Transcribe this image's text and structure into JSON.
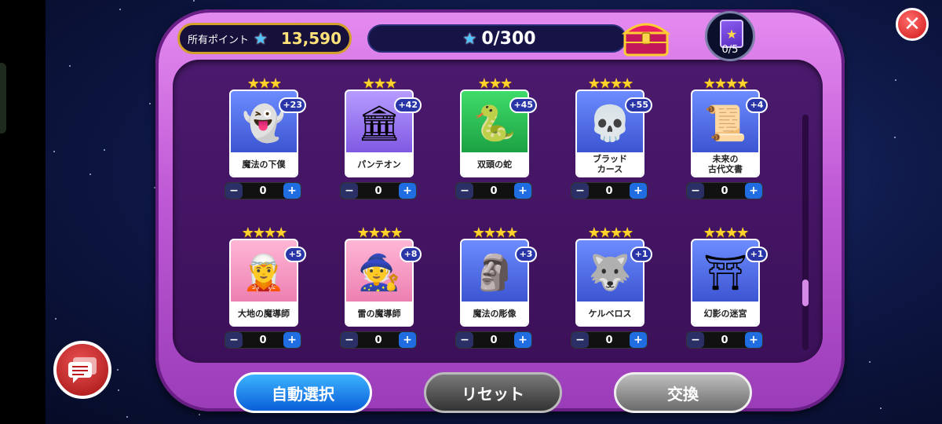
{
  "header": {
    "points_label": "所有ポイント",
    "points_value": "13,590",
    "progress_text": "0/300",
    "card_count": "0/5"
  },
  "items": [
    {
      "name": "魔法の下僕",
      "stars": "★★★",
      "bonus": "+23",
      "qty": "0",
      "bg": "bg-blue",
      "icon": "hooded-ghost-icon",
      "glyph": "👻"
    },
    {
      "name": "パンテオン",
      "stars": "★★★",
      "bonus": "+42",
      "qty": "0",
      "bg": "bg-purple",
      "icon": "temple-icon",
      "glyph": "🏛"
    },
    {
      "name": "双頭の蛇",
      "stars": "★★★",
      "bonus": "+45",
      "qty": "0",
      "bg": "bg-green",
      "icon": "snake-icon",
      "glyph": "🐍"
    },
    {
      "name": "ブラッド\nカース",
      "stars": "★★★★",
      "bonus": "+55",
      "qty": "0",
      "bg": "bg-blue",
      "icon": "blood-skull-chalice-icon",
      "glyph": "💀"
    },
    {
      "name": "未来の\n古代文書",
      "stars": "★★★★",
      "bonus": "+4",
      "qty": "0",
      "bg": "bg-blue",
      "icon": "scroll-icon",
      "glyph": "📜"
    },
    {
      "name": "大地の魔導師",
      "stars": "★★★★",
      "bonus": "+5",
      "qty": "0",
      "bg": "bg-pink",
      "icon": "earth-mage-icon",
      "glyph": "🧝"
    },
    {
      "name": "雷の魔導師",
      "stars": "★★★★",
      "bonus": "+8",
      "qty": "0",
      "bg": "bg-pink",
      "icon": "thunder-mage-icon",
      "glyph": "🧙"
    },
    {
      "name": "魔法の彫像",
      "stars": "★★★★",
      "bonus": "+3",
      "qty": "0",
      "bg": "bg-blue",
      "icon": "gargoyle-statue-icon",
      "glyph": "🗿"
    },
    {
      "name": "ケルベロス",
      "stars": "★★★★",
      "bonus": "+1",
      "qty": "0",
      "bg": "bg-blue",
      "icon": "cerberus-icon",
      "glyph": "🐺"
    },
    {
      "name": "幻影の迷宮",
      "stars": "★★★★",
      "bonus": "+1",
      "qty": "0",
      "bg": "bg-blue",
      "icon": "stone-gate-icon",
      "glyph": "⛩"
    }
  ],
  "buttons": {
    "auto_select": "自動選択",
    "reset": "リセット",
    "exchange": "交換"
  },
  "colors": {
    "frame": "#c05ad6",
    "accent_blue": "#1f6de0",
    "star_gold": "#ffd22e",
    "close_red": "#d01818"
  }
}
